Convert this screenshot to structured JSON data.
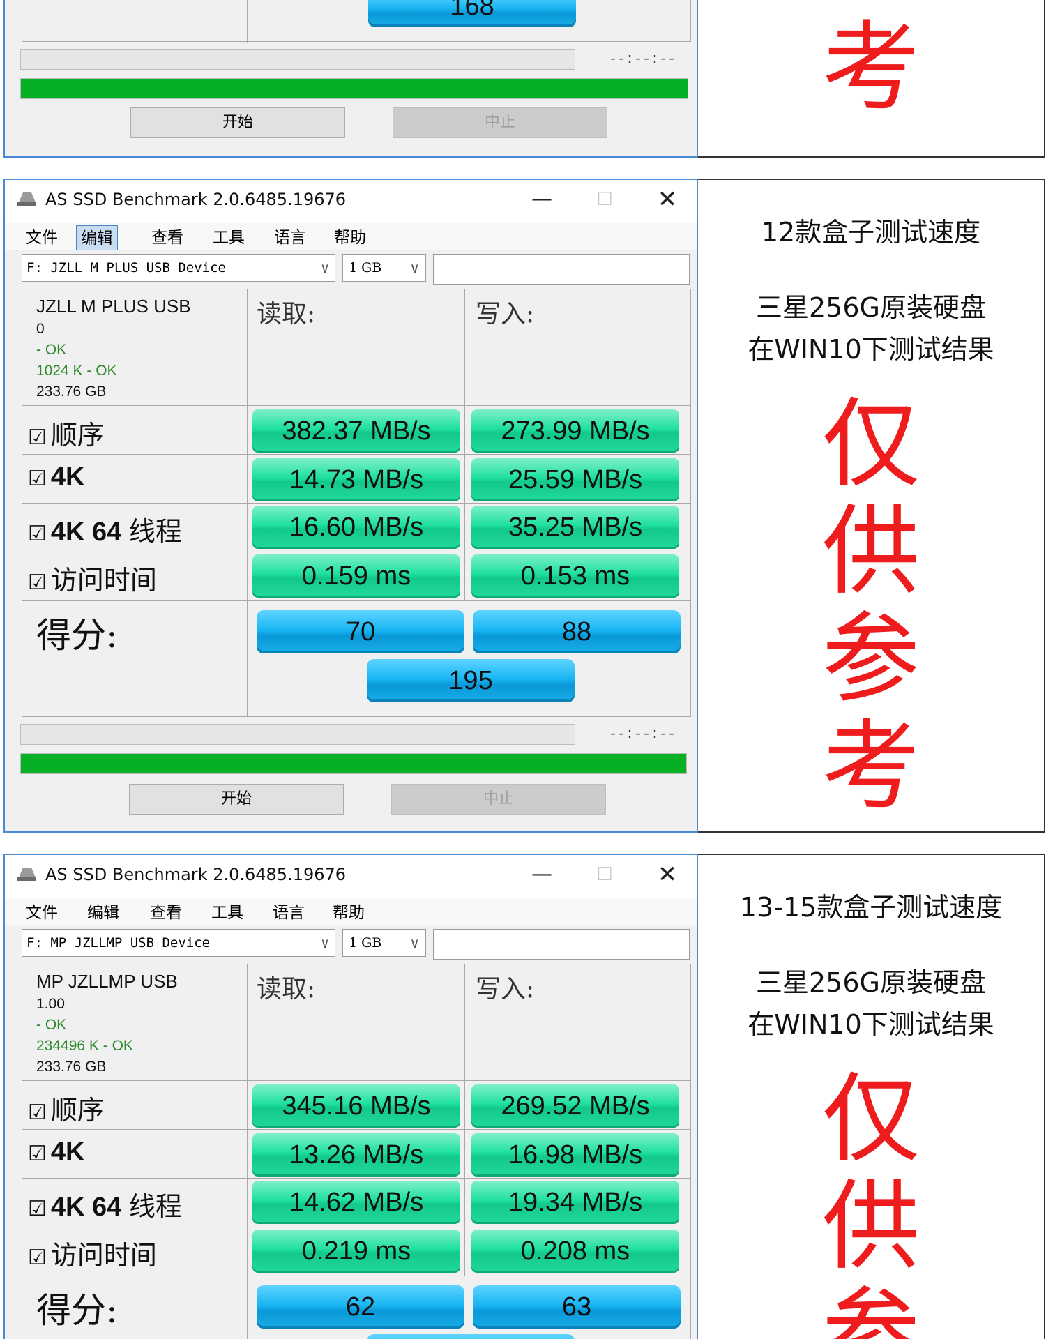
{
  "colors": {
    "accent": "#4a8ad4",
    "green_bar": "#1fe0a0",
    "blue_bar": "#1ab6f4",
    "progress": "#06b025",
    "note_red": "#ee1c1c"
  },
  "top_fragment": {
    "total_score": "168",
    "timer": "--:--:--",
    "start_button": "开始",
    "stop_button": "中止",
    "side_char": "考"
  },
  "panels": [
    {
      "window_title": "AS SSD Benchmark 2.0.6485.19676",
      "menu": [
        "文件",
        "编辑",
        "查看",
        "工具",
        "语言",
        "帮助"
      ],
      "active_menu_index": 1,
      "drive": "F: JZLL M PLUS USB Device",
      "size": "1 GB",
      "device_name": "JZLL M PLUS USB",
      "info_lines": [
        "0",
        " - OK",
        "1024 K - OK",
        "233.76 GB"
      ],
      "read_header": "读取:",
      "write_header": "写入:",
      "rows": [
        {
          "check": "☑",
          "label": "顺序",
          "label_bold": "",
          "read": "382.37 MB/s",
          "write": "273.99 MB/s"
        },
        {
          "check": "☑",
          "label": "",
          "label_bold": "4K",
          "read": "14.73 MB/s",
          "write": "25.59 MB/s"
        },
        {
          "check": "☑",
          "label": "线程",
          "label_bold": "4K 64",
          "read": "16.60 MB/s",
          "write": "35.25 MB/s"
        },
        {
          "check": "☑",
          "label": "访问时间",
          "label_bold": "",
          "read": "0.159 ms",
          "write": "0.153 ms"
        }
      ],
      "score_label": "得分:",
      "score_read": "70",
      "score_write": "88",
      "score_total": "195",
      "timer": "--:--:--",
      "start_button": "开始",
      "stop_button": "中止",
      "side_title": "12款盒子测试速度",
      "side_line1": "三星256G原装硬盘",
      "side_line2": "在WIN10下测试结果",
      "side_chars": [
        "仅",
        "供",
        "参",
        "考"
      ]
    },
    {
      "window_title": "AS SSD Benchmark 2.0.6485.19676",
      "menu": [
        "文件",
        "编辑",
        "查看",
        "工具",
        "语言",
        "帮助"
      ],
      "active_menu_index": -1,
      "drive": "F: MP JZLLMP USB Device",
      "size": "1 GB",
      "device_name": "MP JZLLMP USB",
      "info_lines": [
        "1.00",
        " - OK",
        "234496 K - OK",
        "233.76 GB"
      ],
      "read_header": "读取:",
      "write_header": "写入:",
      "rows": [
        {
          "check": "☑",
          "label": "顺序",
          "label_bold": "",
          "read": "345.16 MB/s",
          "write": "269.52 MB/s"
        },
        {
          "check": "☑",
          "label": "",
          "label_bold": "4K",
          "read": "13.26 MB/s",
          "write": "16.98 MB/s"
        },
        {
          "check": "☑",
          "label": "线程",
          "label_bold": "4K 64",
          "read": "14.62 MB/s",
          "write": "19.34 MB/s"
        },
        {
          "check": "☑",
          "label": "访问时间",
          "label_bold": "",
          "read": "0.219 ms",
          "write": "0.208 ms"
        }
      ],
      "score_label": "得分:",
      "score_read": "62",
      "score_write": "63",
      "side_title": "13-15款盒子测试速度",
      "side_line1": "三星256G原装硬盘",
      "side_line2": "在WIN10下测试结果",
      "side_chars": [
        "仅",
        "供",
        "参"
      ]
    }
  ]
}
